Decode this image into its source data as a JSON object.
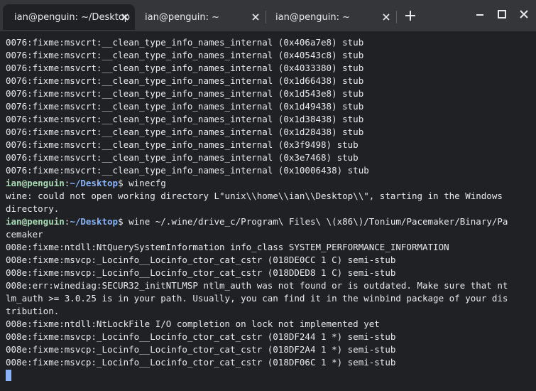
{
  "tabs": [
    {
      "title": "ian@penguin: ~/Desktop",
      "active": true
    },
    {
      "title": "ian@penguin: ~",
      "active": false
    },
    {
      "title": "ian@penguin: ~",
      "active": false
    }
  ],
  "prompt": {
    "user": "ian@penguin",
    "sep": ":",
    "path": "~/Desktop",
    "sigil": "$ "
  },
  "output": {
    "l01": "0076:fixme:msvcrt:__clean_type_info_names_internal (0x406a7e8) stub",
    "l02": "0076:fixme:msvcrt:__clean_type_info_names_internal (0x40543c8) stub",
    "l03": "0076:fixme:msvcrt:__clean_type_info_names_internal (0x4033380) stub",
    "l04": "0076:fixme:msvcrt:__clean_type_info_names_internal (0x1d66438) stub",
    "l05": "0076:fixme:msvcrt:__clean_type_info_names_internal (0x1d543e8) stub",
    "l06": "0076:fixme:msvcrt:__clean_type_info_names_internal (0x1d49438) stub",
    "l07": "0076:fixme:msvcrt:__clean_type_info_names_internal (0x1d38438) stub",
    "l08": "0076:fixme:msvcrt:__clean_type_info_names_internal (0x1d28438) stub",
    "l09": "0076:fixme:msvcrt:__clean_type_info_names_internal (0x3f9498) stub",
    "l10": "0076:fixme:msvcrt:__clean_type_info_names_internal (0x3e7468) stub",
    "l11": "0076:fixme:msvcrt:__clean_type_info_names_internal (0x10006438) stub",
    "cmd1": "winecfg",
    "l13": "wine: could not open working directory L\"unix\\\\home\\\\ian\\\\Desktop\\\\\", starting in the Windows",
    "l14": "directory.",
    "cmd2": "wine ~/.wine/drive_c/Program\\ Files\\ \\(x86\\)/Tonium/Pacemaker/Binary/Pa",
    "l16": "cemaker",
    "l17": "008e:fixme:ntdll:NtQuerySystemInformation info_class SYSTEM_PERFORMANCE_INFORMATION",
    "l18": "008e:fixme:msvcp:_Locinfo__Locinfo_ctor_cat_cstr (018DE0CC 1 C) semi-stub",
    "l19": "008e:fixme:msvcp:_Locinfo__Locinfo_ctor_cat_cstr (018DDED8 1 C) semi-stub",
    "l20": "008e:err:winediag:SECUR32_initNTLMSP ntlm_auth was not found or is outdated. Make sure that nt",
    "l21": "lm_auth >= 3.0.25 is in your path. Usually, you can find it in the winbind package of your dis",
    "l22": "tribution.",
    "l23": "008e:fixme:ntdll:NtLockFile I/O completion on lock not implemented yet",
    "l24": "008e:fixme:msvcp:_Locinfo__Locinfo_ctor_cat_cstr (018DF244 1 *) semi-stub",
    "l25": "008e:fixme:msvcp:_Locinfo__Locinfo_ctor_cat_cstr (018DF2A4 1 *) semi-stub",
    "l26": "008e:fixme:msvcp:_Locinfo__Locinfo_ctor_cat_cstr (018DF06C 1 *) semi-stub"
  },
  "icons": {
    "tab_close": "close-icon",
    "new_tab": "plus-icon",
    "minimize": "minimize-icon",
    "maximize": "maximize-icon",
    "close_window": "close-icon"
  },
  "colors": {
    "background": "#202124",
    "tabbar": "#35363a",
    "text": "#e8eaed",
    "prompt_user": "#a8dab5",
    "prompt_path": "#8ab4f8",
    "cursor": "#8ab4f8"
  }
}
